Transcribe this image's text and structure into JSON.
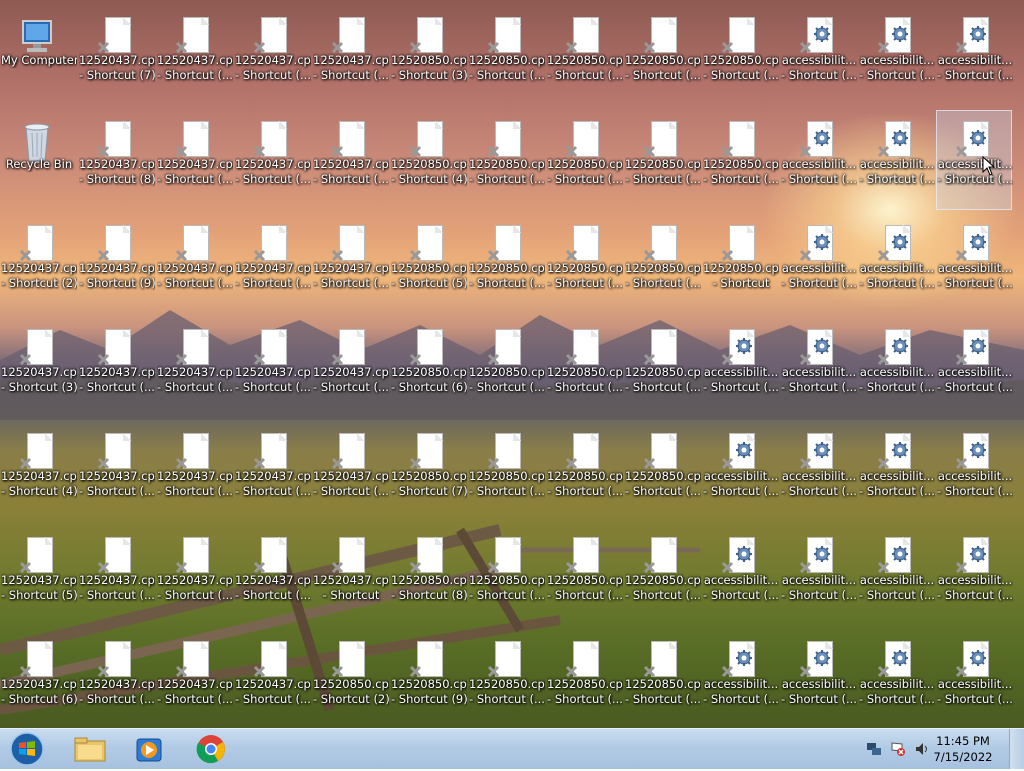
{
  "desktop": {
    "icons": [
      {
        "label1": "My Computer",
        "label2": "",
        "type": "computer"
      },
      {
        "label1": "12520437.cpx",
        "label2": "- Shortcut (7)",
        "type": "doc"
      },
      {
        "label1": "12520437.cpx",
        "label2": "- Shortcut (...",
        "type": "doc"
      },
      {
        "label1": "12520437.cpx",
        "label2": "- Shortcut (...",
        "type": "doc"
      },
      {
        "label1": "12520437.cpx",
        "label2": "- Shortcut (...",
        "type": "doc"
      },
      {
        "label1": "12520850.cpx",
        "label2": "- Shortcut (3)",
        "type": "doc"
      },
      {
        "label1": "12520850.cpx",
        "label2": "- Shortcut (...",
        "type": "doc"
      },
      {
        "label1": "12520850.cpx",
        "label2": "- Shortcut (...",
        "type": "doc"
      },
      {
        "label1": "12520850.cpx",
        "label2": "- Shortcut (...",
        "type": "doc"
      },
      {
        "label1": "12520850.cpx",
        "label2": "- Shortcut (...",
        "type": "doc"
      },
      {
        "label1": "accessibilit...",
        "label2": "- Shortcut (...",
        "type": "gear"
      },
      {
        "label1": "accessibilit...",
        "label2": "- Shortcut (...",
        "type": "gear"
      },
      {
        "label1": "accessibilit...",
        "label2": "- Shortcut (...",
        "type": "gear"
      },
      {
        "label1": "Recycle Bin",
        "label2": "",
        "type": "bin"
      },
      {
        "label1": "12520437.cpx",
        "label2": "- Shortcut (8)",
        "type": "doc"
      },
      {
        "label1": "12520437.cpx",
        "label2": "- Shortcut (...",
        "type": "doc"
      },
      {
        "label1": "12520437.cpx",
        "label2": "- Shortcut (...",
        "type": "doc"
      },
      {
        "label1": "12520437.cpx",
        "label2": "- Shortcut (...",
        "type": "doc"
      },
      {
        "label1": "12520850.cpx",
        "label2": "- Shortcut (4)",
        "type": "doc"
      },
      {
        "label1": "12520850.cpx",
        "label2": "- Shortcut (...",
        "type": "doc"
      },
      {
        "label1": "12520850.cpx",
        "label2": "- Shortcut (...",
        "type": "doc"
      },
      {
        "label1": "12520850.cpx",
        "label2": "- Shortcut (...",
        "type": "doc"
      },
      {
        "label1": "12520850.cpx",
        "label2": "- Shortcut (...",
        "type": "doc"
      },
      {
        "label1": "accessibilit...",
        "label2": "- Shortcut (...",
        "type": "gear"
      },
      {
        "label1": "accessibilit...",
        "label2": "- Shortcut (...",
        "type": "gear"
      },
      {
        "label1": "accessibilit...",
        "label2": "- Shortcut (...",
        "type": "gear",
        "selected": true
      },
      {
        "label1": "12520437.cpx",
        "label2": "- Shortcut (2)",
        "type": "doc"
      },
      {
        "label1": "12520437.cpx",
        "label2": "- Shortcut (9)",
        "type": "doc"
      },
      {
        "label1": "12520437.cpx",
        "label2": "- Shortcut (...",
        "type": "doc"
      },
      {
        "label1": "12520437.cpx",
        "label2": "- Shortcut (...",
        "type": "doc"
      },
      {
        "label1": "12520437.cpx",
        "label2": "- Shortcut (...",
        "type": "doc"
      },
      {
        "label1": "12520850.cpx",
        "label2": "- Shortcut (5)",
        "type": "doc"
      },
      {
        "label1": "12520850.cpx",
        "label2": "- Shortcut (...",
        "type": "doc"
      },
      {
        "label1": "12520850.cpx",
        "label2": "- Shortcut (...",
        "type": "doc"
      },
      {
        "label1": "12520850.cpx",
        "label2": "- Shortcut (...",
        "type": "doc"
      },
      {
        "label1": "12520850.cpx",
        "label2": "- Shortcut",
        "type": "doc"
      },
      {
        "label1": "accessibilit...",
        "label2": "- Shortcut (...",
        "type": "gear"
      },
      {
        "label1": "accessibilit...",
        "label2": "- Shortcut (...",
        "type": "gear"
      },
      {
        "label1": "accessibilit...",
        "label2": "- Shortcut (...",
        "type": "gear"
      },
      {
        "label1": "12520437.cpx",
        "label2": "- Shortcut (3)",
        "type": "doc"
      },
      {
        "label1": "12520437.cpx",
        "label2": "- Shortcut (...",
        "type": "doc"
      },
      {
        "label1": "12520437.cpx",
        "label2": "- Shortcut (...",
        "type": "doc"
      },
      {
        "label1": "12520437.cpx",
        "label2": "- Shortcut (...",
        "type": "doc"
      },
      {
        "label1": "12520437.cpx",
        "label2": "- Shortcut (...",
        "type": "doc"
      },
      {
        "label1": "12520850.cpx",
        "label2": "- Shortcut (6)",
        "type": "doc"
      },
      {
        "label1": "12520850.cpx",
        "label2": "- Shortcut (...",
        "type": "doc"
      },
      {
        "label1": "12520850.cpx",
        "label2": "- Shortcut (...",
        "type": "doc"
      },
      {
        "label1": "12520850.cpx",
        "label2": "- Shortcut (...",
        "type": "doc"
      },
      {
        "label1": "accessibilit...",
        "label2": "- Shortcut (...",
        "type": "gear"
      },
      {
        "label1": "accessibilit...",
        "label2": "- Shortcut (...",
        "type": "gear"
      },
      {
        "label1": "accessibilit...",
        "label2": "- Shortcut (...",
        "type": "gear"
      },
      {
        "label1": "accessibilit...",
        "label2": "- Shortcut (...",
        "type": "gear"
      },
      {
        "label1": "12520437.cpx",
        "label2": "- Shortcut (4)",
        "type": "doc"
      },
      {
        "label1": "12520437.cpx",
        "label2": "- Shortcut (...",
        "type": "doc"
      },
      {
        "label1": "12520437.cpx",
        "label2": "- Shortcut (...",
        "type": "doc"
      },
      {
        "label1": "12520437.cpx",
        "label2": "- Shortcut (...",
        "type": "doc"
      },
      {
        "label1": "12520437.cpx",
        "label2": "- Shortcut (...",
        "type": "doc"
      },
      {
        "label1": "12520850.cpx",
        "label2": "- Shortcut (7)",
        "type": "doc"
      },
      {
        "label1": "12520850.cpx",
        "label2": "- Shortcut (...",
        "type": "doc"
      },
      {
        "label1": "12520850.cpx",
        "label2": "- Shortcut (...",
        "type": "doc"
      },
      {
        "label1": "12520850.cpx",
        "label2": "- Shortcut (...",
        "type": "doc"
      },
      {
        "label1": "accessibilit...",
        "label2": "- Shortcut (...",
        "type": "gear"
      },
      {
        "label1": "accessibilit...",
        "label2": "- Shortcut (...",
        "type": "gear"
      },
      {
        "label1": "accessibilit...",
        "label2": "- Shortcut (...",
        "type": "gear"
      },
      {
        "label1": "accessibilit...",
        "label2": "- Shortcut (...",
        "type": "gear"
      },
      {
        "label1": "12520437.cpx",
        "label2": "- Shortcut (5)",
        "type": "doc"
      },
      {
        "label1": "12520437.cpx",
        "label2": "- Shortcut (...",
        "type": "doc"
      },
      {
        "label1": "12520437.cpx",
        "label2": "- Shortcut (...",
        "type": "doc"
      },
      {
        "label1": "12520437.cpx",
        "label2": "- Shortcut (...",
        "type": "doc"
      },
      {
        "label1": "12520437.cpx",
        "label2": "- Shortcut",
        "type": "doc"
      },
      {
        "label1": "12520850.cpx",
        "label2": "- Shortcut (8)",
        "type": "doc"
      },
      {
        "label1": "12520850.cpx",
        "label2": "- Shortcut (...",
        "type": "doc"
      },
      {
        "label1": "12520850.cpx",
        "label2": "- Shortcut (...",
        "type": "doc"
      },
      {
        "label1": "12520850.cpx",
        "label2": "- Shortcut (...",
        "type": "doc"
      },
      {
        "label1": "accessibilit...",
        "label2": "- Shortcut (...",
        "type": "gear"
      },
      {
        "label1": "accessibilit...",
        "label2": "- Shortcut (...",
        "type": "gear"
      },
      {
        "label1": "accessibilit...",
        "label2": "- Shortcut (...",
        "type": "gear"
      },
      {
        "label1": "accessibilit...",
        "label2": "- Shortcut (...",
        "type": "gear"
      },
      {
        "label1": "12520437.cpx",
        "label2": "- Shortcut (6)",
        "type": "doc"
      },
      {
        "label1": "12520437.cpx",
        "label2": "- Shortcut (...",
        "type": "doc"
      },
      {
        "label1": "12520437.cpx",
        "label2": "- Shortcut (...",
        "type": "doc"
      },
      {
        "label1": "12520437.cpx",
        "label2": "- Shortcut (...",
        "type": "doc"
      },
      {
        "label1": "12520850.cpx",
        "label2": "- Shortcut (2)",
        "type": "doc"
      },
      {
        "label1": "12520850.cpx",
        "label2": "- Shortcut (9)",
        "type": "doc"
      },
      {
        "label1": "12520850.cpx",
        "label2": "- Shortcut (...",
        "type": "doc"
      },
      {
        "label1": "12520850.cpx",
        "label2": "- Shortcut (...",
        "type": "doc"
      },
      {
        "label1": "12520850.cpx",
        "label2": "- Shortcut (...",
        "type": "doc"
      },
      {
        "label1": "accessibilit...",
        "label2": "- Shortcut (...",
        "type": "gear"
      },
      {
        "label1": "accessibilit...",
        "label2": "- Shortcut (...",
        "type": "gear"
      },
      {
        "label1": "accessibilit...",
        "label2": "- Shortcut (...",
        "type": "gear"
      },
      {
        "label1": "accessibilit...",
        "label2": "- Shortcut (...",
        "type": "gear"
      }
    ]
  },
  "taskbar": {
    "start_icon": "windows-orb-icon",
    "pinned": [
      {
        "name": "explorer-icon"
      },
      {
        "name": "media-player-icon"
      },
      {
        "name": "chrome-icon"
      }
    ],
    "tray_icons": [
      "network-icon",
      "action-center-flag-icon",
      "volume-icon"
    ],
    "time": "11:45 PM",
    "date": "7/15/2022"
  },
  "colors": {
    "taskbar": "#b2cbe5",
    "label_text": "#ffffff"
  }
}
